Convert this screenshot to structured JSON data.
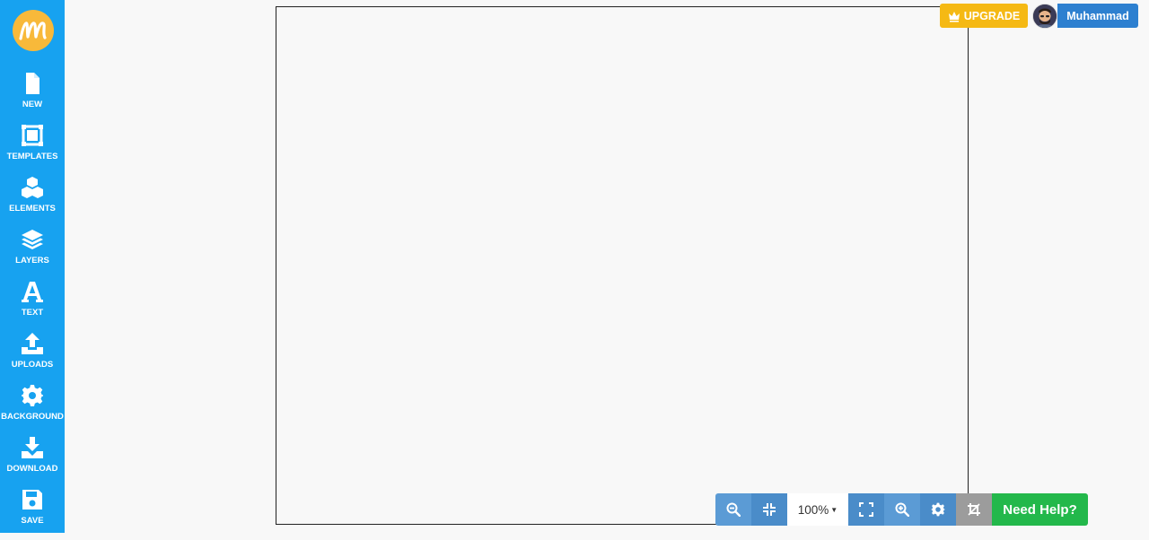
{
  "brand": {
    "logo_letter": "m",
    "logo_color": "#f8b93a",
    "sidebar_color": "#17a2f0"
  },
  "sidebar": {
    "items": [
      {
        "label": "NEW",
        "icon": "file-icon"
      },
      {
        "label": "TEMPLATES",
        "icon": "template-icon"
      },
      {
        "label": "ELEMENTS",
        "icon": "cubes-icon"
      },
      {
        "label": "LAYERS",
        "icon": "layers-icon"
      },
      {
        "label": "TEXT",
        "icon": "text-icon"
      },
      {
        "label": "UPLOADS",
        "icon": "upload-icon"
      },
      {
        "label": "BACKGROUND",
        "icon": "gear-icon"
      },
      {
        "label": "DOWNLOAD",
        "icon": "download-icon"
      },
      {
        "label": "SAVE",
        "icon": "save-icon"
      }
    ]
  },
  "header": {
    "upgrade_label": "UPGRADE",
    "upgrade_color": "#f5b914",
    "user_name": "Muhammad",
    "user_color": "#2d80d0"
  },
  "toolbar": {
    "zoom_value": "100%",
    "help_label": "Need Help?",
    "help_color": "#23b84b",
    "buttons": [
      "zoom-out-icon",
      "compress-icon",
      "expand-icon",
      "zoom-in-icon",
      "gear-icon",
      "crop-icon"
    ]
  }
}
